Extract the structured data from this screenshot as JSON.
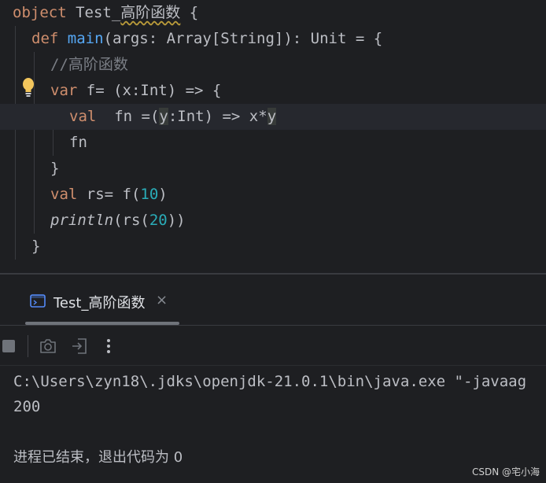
{
  "editor": {
    "lines": [
      {
        "kw": "object",
        "rest": " Test_",
        "name": "高阶函数",
        "tail": " {"
      },
      {
        "kw": "def",
        "fname": "main",
        "rest": "(args: Array[String]): Unit = {"
      },
      {
        "comment": "//高阶函数"
      },
      {
        "kw": "var",
        "rest": " f= (x:Int) => {"
      },
      {
        "kw": "val",
        "rest_a": "  fn =(",
        "y": "y",
        "rest_b": ":Int) => x*",
        "y2": "y"
      },
      {
        "text": "fn"
      },
      {
        "text": "}"
      },
      {
        "kw": "val",
        "rest": " rs= f(",
        "num": "10",
        "tail": ")"
      },
      {
        "fname": "println",
        "rest": "(rs(",
        "num": "20",
        "tail": "))"
      },
      {
        "text": "}"
      }
    ],
    "bulb_icon": "lightbulb-icon"
  },
  "run_panel": {
    "tab_label": "Test_高阶函数",
    "tab_icon": "console-icon",
    "close_glyph": "×",
    "toolbar_icons": [
      "stop-icon",
      "camera-icon",
      "exit-icon",
      "more-vertical-icon"
    ]
  },
  "console": {
    "lines": [
      "C:\\Users\\zyn18\\.jdks\\openjdk-21.0.1\\bin\\java.exe \"-javaag",
      "200",
      "",
      "进程已结束，退出代码为 0"
    ]
  },
  "watermark": "CSDN @宅小海",
  "colors": {
    "background": "#1e1f22",
    "keyword": "#cf8e6d",
    "function": "#56a8f5",
    "number": "#2aacb8",
    "comment": "#7a7e85",
    "text": "#bcbec4"
  }
}
